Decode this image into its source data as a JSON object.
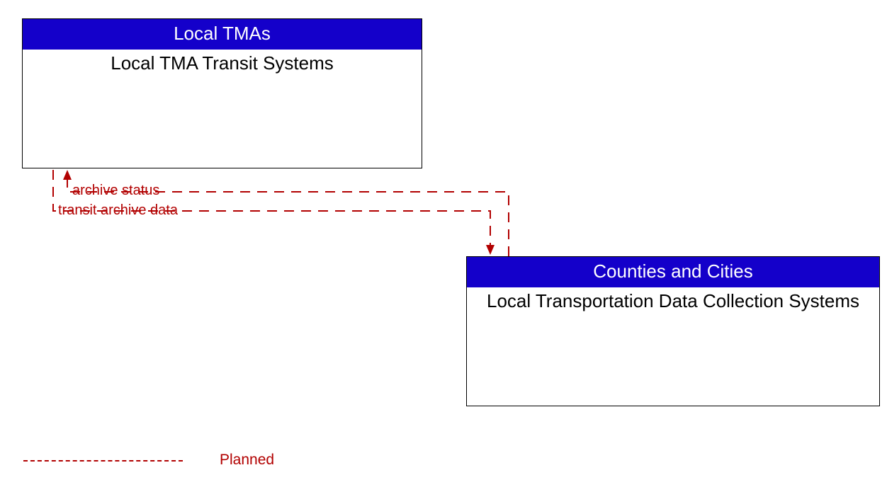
{
  "diagram": {
    "entities": {
      "top": {
        "header": "Local TMAs",
        "title": "Local TMA Transit Systems"
      },
      "bottom": {
        "header": "Counties and Cities",
        "title": "Local Transportation Data Collection Systems"
      }
    },
    "flows": {
      "archive_status": {
        "label": "archive status",
        "style": "planned",
        "direction": "to_top"
      },
      "transit_archive_data": {
        "label": "transit archive data",
        "style": "planned",
        "direction": "to_bottom"
      }
    },
    "legend": {
      "planned": "Planned"
    },
    "colors": {
      "entity_header_bg": "#1400ca",
      "entity_header_fg": "#ffffff",
      "entity_border": "#000000",
      "flow_planned": "#b20000"
    }
  }
}
